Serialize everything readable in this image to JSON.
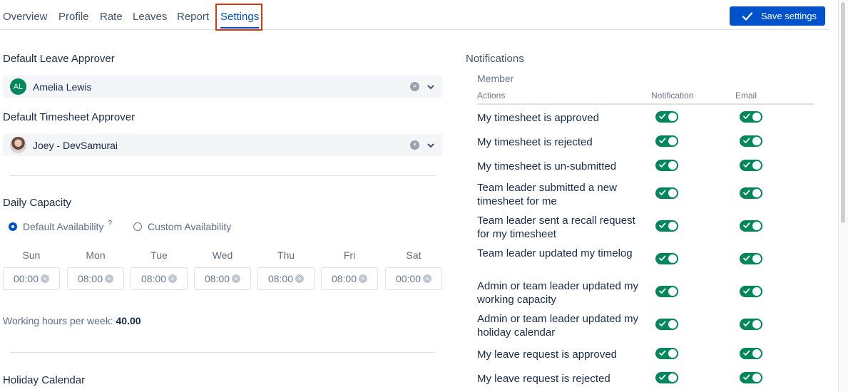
{
  "tabs": [
    {
      "label": "Overview"
    },
    {
      "label": "Profile"
    },
    {
      "label": "Rate"
    },
    {
      "label": "Leaves"
    },
    {
      "label": "Report"
    },
    {
      "label": "Settings",
      "active": true
    }
  ],
  "save_button": {
    "label": "Save settings",
    "icon": "check-icon",
    "color": "#0052cc"
  },
  "leave_approver": {
    "label": "Default Leave Approver",
    "initials": "AL",
    "value": "Amelia Lewis"
  },
  "timesheet_approver": {
    "label": "Default Timesheet Approver",
    "value": "Joey - DevSamurai"
  },
  "capacity": {
    "label": "Daily Capacity",
    "options": [
      {
        "label": "Default Availability",
        "help": "?",
        "selected": true
      },
      {
        "label": "Custom Availability",
        "selected": false
      }
    ],
    "days": [
      {
        "day": "Sun",
        "time": "00:00"
      },
      {
        "day": "Mon",
        "time": "08:00"
      },
      {
        "day": "Tue",
        "time": "08:00"
      },
      {
        "day": "Wed",
        "time": "08:00"
      },
      {
        "day": "Thu",
        "time": "08:00"
      },
      {
        "day": "Fri",
        "time": "08:00"
      },
      {
        "day": "Sat",
        "time": "00:00"
      }
    ],
    "hours_label": "Working hours per week:",
    "hours_value": "40.00"
  },
  "holiday": {
    "label": "Holiday Calendar"
  },
  "notifications": {
    "title": "Notifications",
    "group": "Member",
    "columns": {
      "actions": "Actions",
      "notification": "Notification",
      "email": "Email"
    },
    "rows": [
      {
        "label": "My timesheet is approved",
        "notification": true,
        "email": true
      },
      {
        "label": "My timesheet is rejected",
        "notification": true,
        "email": true
      },
      {
        "label": "My timesheet is un-submitted",
        "notification": true,
        "email": true
      },
      {
        "label": "Team leader submitted a new timesheet for me",
        "notification": true,
        "email": true
      },
      {
        "label": "Team leader sent a recall request for my timesheet",
        "notification": true,
        "email": true
      },
      {
        "label": "Team leader updated my timelog",
        "notification": true,
        "email": true
      },
      {
        "label": "Admin or team leader updated my working capacity",
        "notification": true,
        "email": true
      },
      {
        "label": "Admin or team leader updated my holiday calendar",
        "notification": true,
        "email": true
      },
      {
        "label": "My leave request is approved",
        "notification": true,
        "email": true
      },
      {
        "label": "My leave request is rejected",
        "notification": true,
        "email": true
      }
    ],
    "toggle_color": "#00875a"
  }
}
